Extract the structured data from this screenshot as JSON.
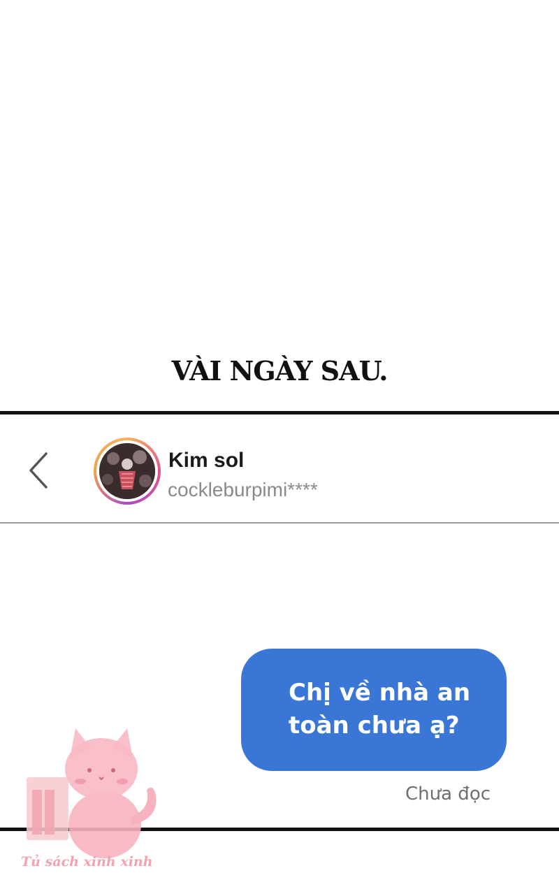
{
  "caption": "VÀI NGÀY SAU.",
  "chat_header": {
    "back_icon": "chevron-left-icon",
    "contact_name": "Kim sol",
    "contact_handle": "cockleburpimi****"
  },
  "messages": [
    {
      "lines": [
        "Chị về nhà an",
        "toàn chưa ạ?"
      ],
      "status": "Chưa đọc",
      "bubble_color": "#3a76d6"
    }
  ],
  "watermark": {
    "text": "Tủ sách xinh xinh",
    "icon": "pink-cat-icon",
    "color": "#f2a2b0"
  }
}
